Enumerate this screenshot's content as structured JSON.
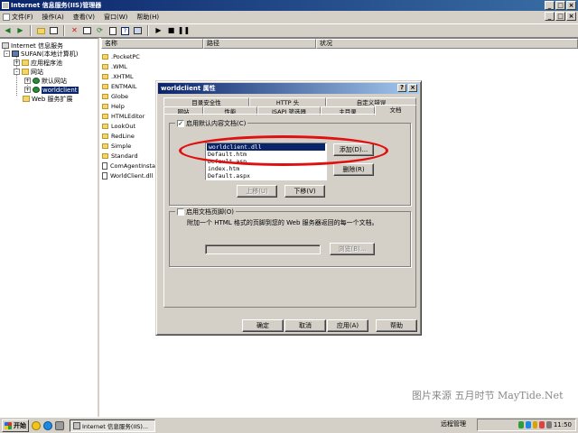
{
  "window": {
    "title": "Internet 信息服务(IIS)管理器",
    "controls": [
      "_",
      "□",
      "×"
    ]
  },
  "menu": {
    "items": [
      "文件(F)",
      "操作(A)",
      "查看(V)",
      "窗口(W)",
      "帮助(H)"
    ],
    "mdi_controls": [
      "_",
      "□",
      "×"
    ]
  },
  "tree": {
    "root": "Internet 信息服务",
    "computer": "SUFAN(本地计算机)",
    "app_pools": "应用程序池",
    "websites": "网站",
    "default_site": "默认网站",
    "worldclient": "worldclient",
    "web_ext": "Web 服务扩展",
    "expand_plus": "+",
    "expand_minus": "-"
  },
  "list": {
    "columns": [
      "名称",
      "路径",
      "状况"
    ],
    "items": [
      {
        "name": ".PocketPC",
        "type": "folder"
      },
      {
        "name": ".WML",
        "type": "folder"
      },
      {
        "name": ".XHTML",
        "type": "folder"
      },
      {
        "name": "ENTMAIL",
        "type": "folder"
      },
      {
        "name": "Globe",
        "type": "folder"
      },
      {
        "name": "Help",
        "type": "folder"
      },
      {
        "name": "HTMLEditor",
        "type": "folder"
      },
      {
        "name": "LookOut",
        "type": "folder"
      },
      {
        "name": "RedLine",
        "type": "folder"
      },
      {
        "name": "Simple",
        "type": "folder"
      },
      {
        "name": "Standard",
        "type": "folder"
      },
      {
        "name": "ComAgentInstal",
        "type": "file"
      },
      {
        "name": "WorldClient.dll",
        "type": "file"
      }
    ]
  },
  "dialog": {
    "title": "worldclient 属性",
    "title_buttons": [
      "?",
      "×"
    ],
    "tabs_row1": [
      "目录安全性",
      "HTTP 头",
      "自定义错误"
    ],
    "tabs_row2": [
      "网站",
      "性能",
      "ISAPI 筛选器",
      "主目录",
      "文档"
    ],
    "enable_default_doc": "启用默认内容文档(C)",
    "default_docs": [
      "worldclient.dll",
      "Default.htm",
      "Default.asp",
      "index.htm",
      "Default.aspx"
    ],
    "add_button": "添加(D)...",
    "remove_button": "删除(R)",
    "move_up_button": "上移(U)",
    "move_down_button": "下移(V)",
    "enable_footer": "启用文档页脚(O)",
    "footer_desc": "附加一个 HTML 格式的页脚到您的 Web 服务器返回的每一个文档。",
    "footer_path": "",
    "browse_button": "浏览(B)...",
    "ok_button": "确定",
    "cancel_button": "取消",
    "apply_button": "应用(A)",
    "help_button": "帮助",
    "check_mark": "✓"
  },
  "watermark": "图片来源 五月时节 MayTide.Net",
  "taskbar": {
    "start": "开始",
    "task": "Internet 信息服务(IIS)...",
    "remote_label": "远程管理",
    "clock": "11:50"
  },
  "colors": {
    "title_active": "#0a246a",
    "face": "#d4d0c8",
    "annotation": "#e01010"
  }
}
